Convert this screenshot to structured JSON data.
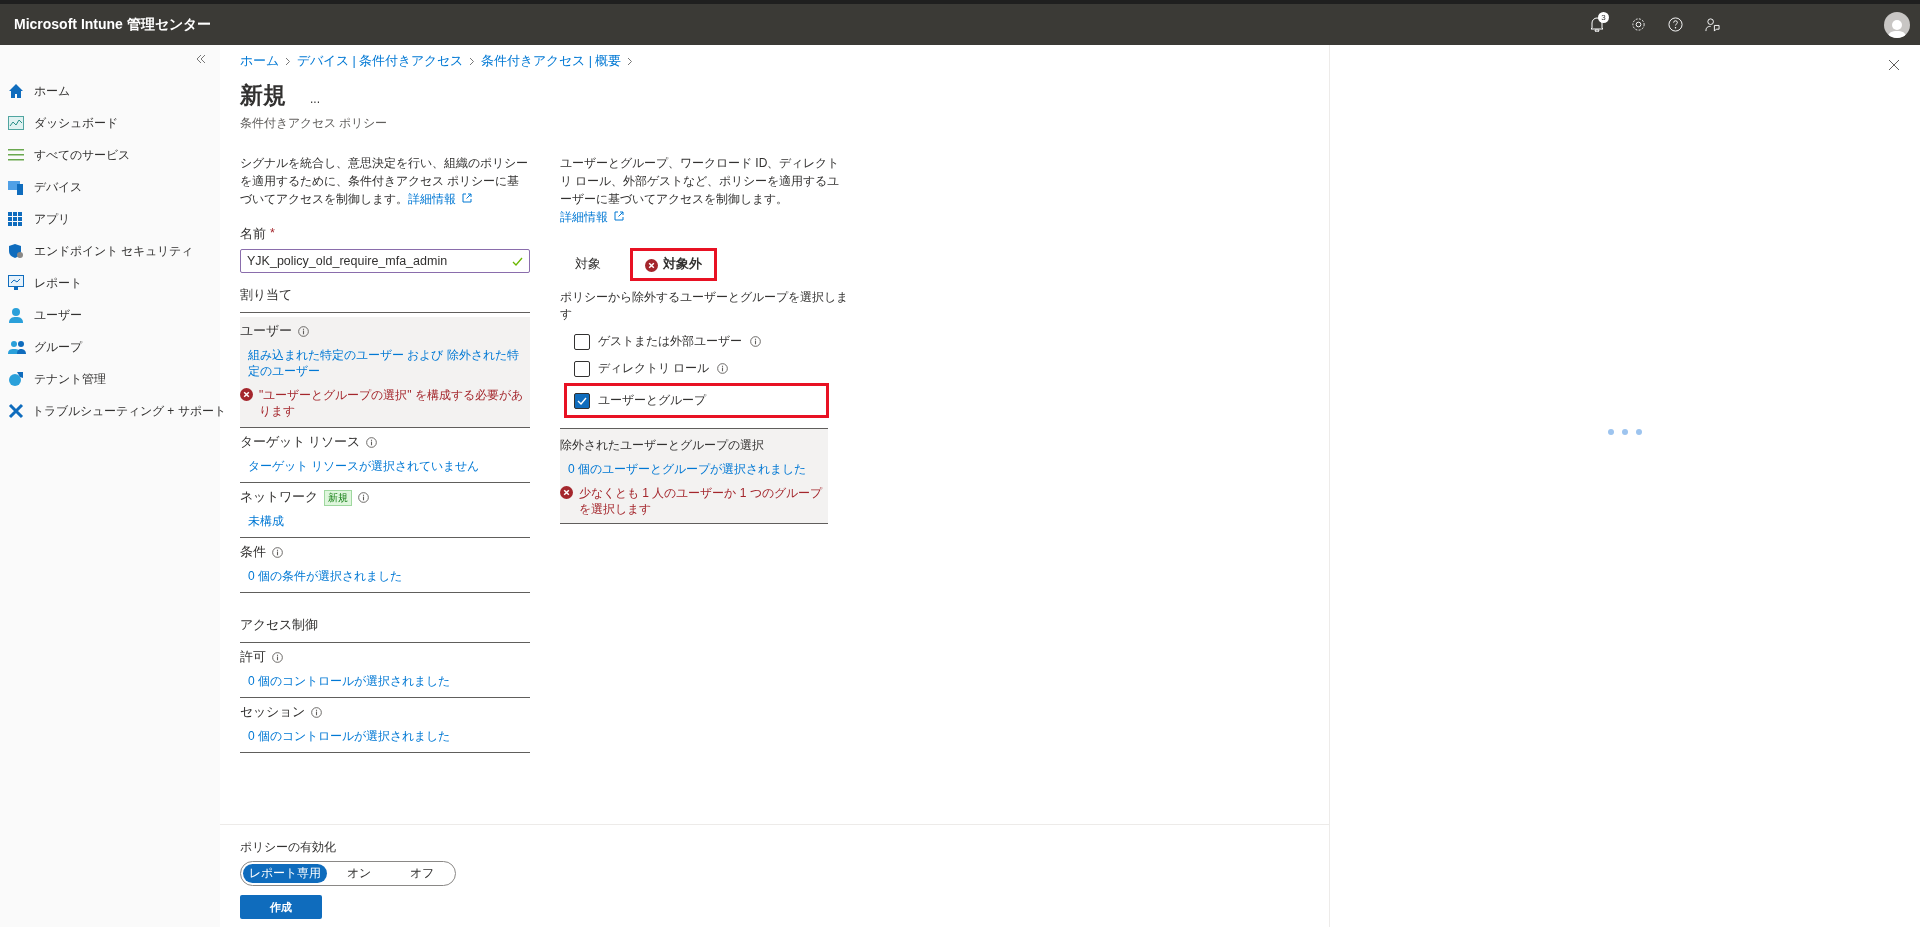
{
  "top_bar": {
    "title": "Microsoft Intune 管理センター",
    "notification_count": "3"
  },
  "sidebar": {
    "items": [
      {
        "label": "ホーム"
      },
      {
        "label": "ダッシュボード"
      },
      {
        "label": "すべてのサービス"
      },
      {
        "label": "デバイス"
      },
      {
        "label": "アプリ"
      },
      {
        "label": "エンドポイント セキュリティ"
      },
      {
        "label": "レポート"
      },
      {
        "label": "ユーザー"
      },
      {
        "label": "グループ"
      },
      {
        "label": "テナント管理"
      },
      {
        "label": "トラブルシューティング + サポート"
      }
    ]
  },
  "breadcrumb": [
    "ホーム",
    "デバイス | 条件付きアクセス",
    "条件付きアクセス | 概要"
  ],
  "page": {
    "title": "新規",
    "more": "...",
    "subtitle": "条件付きアクセス ポリシー"
  },
  "left": {
    "description": "シグナルを統合し、意思決定を行い、組織のポリシーを適用するために、条件付きアクセス ポリシーに基づいてアクセスを制御します。",
    "link": "詳細情報",
    "name_label": "名前",
    "required_mark": "*",
    "name_value": "YJK_policy_old_require_mfa_admin",
    "groups": [
      {
        "heading": "割り当て",
        "sections": [
          {
            "label": "ユーザー",
            "active": true,
            "value": "組み込まれた特定のユーザー および 除外された特定のユーザー",
            "error": "\"ユーザーとグループの選択\" を構成する必要があります"
          },
          {
            "label": "ターゲット リソース",
            "active": false,
            "value": "ターゲット リソースが選択されていません"
          },
          {
            "label": "ネットワーク",
            "active": false,
            "badge": "新規",
            "value": "未構成"
          },
          {
            "label": "条件",
            "active": false,
            "value": "0 個の条件が選択されました"
          }
        ]
      },
      {
        "heading": "アクセス制御",
        "sections": [
          {
            "label": "許可",
            "active": false,
            "value": "0 個のコントロールが選択されました"
          },
          {
            "label": "セッション",
            "active": false,
            "value": "0 個のコントロールが選択されました"
          }
        ]
      }
    ]
  },
  "middle": {
    "description": "ユーザーとグループ、ワークロード ID、ディレクトリ ロール、外部ゲストなど、ポリシーを適用するユーザーに基づいてアクセスを制御します。",
    "link": "詳細情報",
    "tabs": [
      {
        "label": "対象",
        "selected": false,
        "error": false,
        "highlighted": false
      },
      {
        "label": "対象外",
        "selected": true,
        "error": true,
        "highlighted": true
      }
    ],
    "prompt": "ポリシーから除外するユーザーとグループを選択します",
    "options": [
      {
        "label": "ゲストまたは外部ユーザー",
        "checked": false,
        "info": true,
        "highlighted": false
      },
      {
        "label": "ディレクトリ ロール",
        "checked": false,
        "info": true,
        "highlighted": false
      },
      {
        "label": "ユーザーとグループ",
        "checked": true,
        "info": false,
        "highlighted": true
      }
    ],
    "selection": {
      "title": "除外されたユーザーとグループの選択",
      "value": "0 個のユーザーとグループが選択されました",
      "error": "少なくとも 1 人のユーザーか 1 つのグループを選択します"
    }
  },
  "footer": {
    "label": "ポリシーの有効化",
    "options": [
      {
        "label": "レポート専用",
        "selected": true
      },
      {
        "label": "オン",
        "selected": false
      },
      {
        "label": "オフ",
        "selected": false
      }
    ],
    "button": "作成"
  }
}
